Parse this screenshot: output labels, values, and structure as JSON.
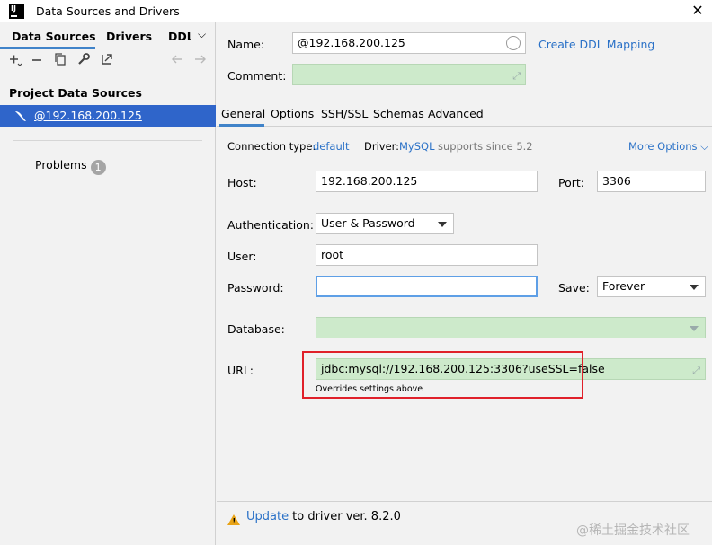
{
  "window": {
    "logo": "IJ",
    "title": "Data Sources and Drivers",
    "close_glyph": "✕"
  },
  "left": {
    "tabs": [
      "Data Sources",
      "Drivers",
      "DDL"
    ],
    "tab_more_glyph": "⌵",
    "section_title": "Project Data Sources",
    "items": [
      {
        "label": "@192.168.200.125"
      }
    ],
    "problems_label": "Problems",
    "problems_count": "1"
  },
  "form": {
    "name_label": "Name:",
    "name_value": "@192.168.200.125",
    "create_ddl_label": "Create DDL Mapping",
    "comment_label": "Comment:",
    "tabs": [
      "General",
      "Options",
      "SSH/SSL",
      "Schemas",
      "Advanced"
    ],
    "connection_type_label": "Connection type:",
    "connection_type_value": "default",
    "driver_label": "Driver:",
    "driver_value": "MySQL",
    "driver_suffix": "supports since 5.2",
    "more_options_label": "More Options ⌵",
    "host_label": "Host:",
    "host_value": "192.168.200.125",
    "port_label": "Port:",
    "port_value": "3306",
    "auth_label": "Authentication:",
    "auth_value": "User & Password",
    "user_label": "User:",
    "user_value": "root",
    "password_label": "Password:",
    "password_value": "",
    "save_label": "Save:",
    "save_value": "Forever",
    "database_label": "Database:",
    "database_value": "",
    "url_label": "URL:",
    "url_value": "jdbc:mysql://192.168.200.125:3306?useSSL=false",
    "url_hint": "Overrides settings above"
  },
  "footer": {
    "update_link": "Update",
    "update_text": " to driver ver. 8.2.0",
    "watermark": "@稀土掘金技术社区"
  },
  "colors": {
    "accent": "#2f65ca",
    "link": "#2a71c7",
    "highlight_box": "#e0202a",
    "green_field": "#cdeacb"
  }
}
